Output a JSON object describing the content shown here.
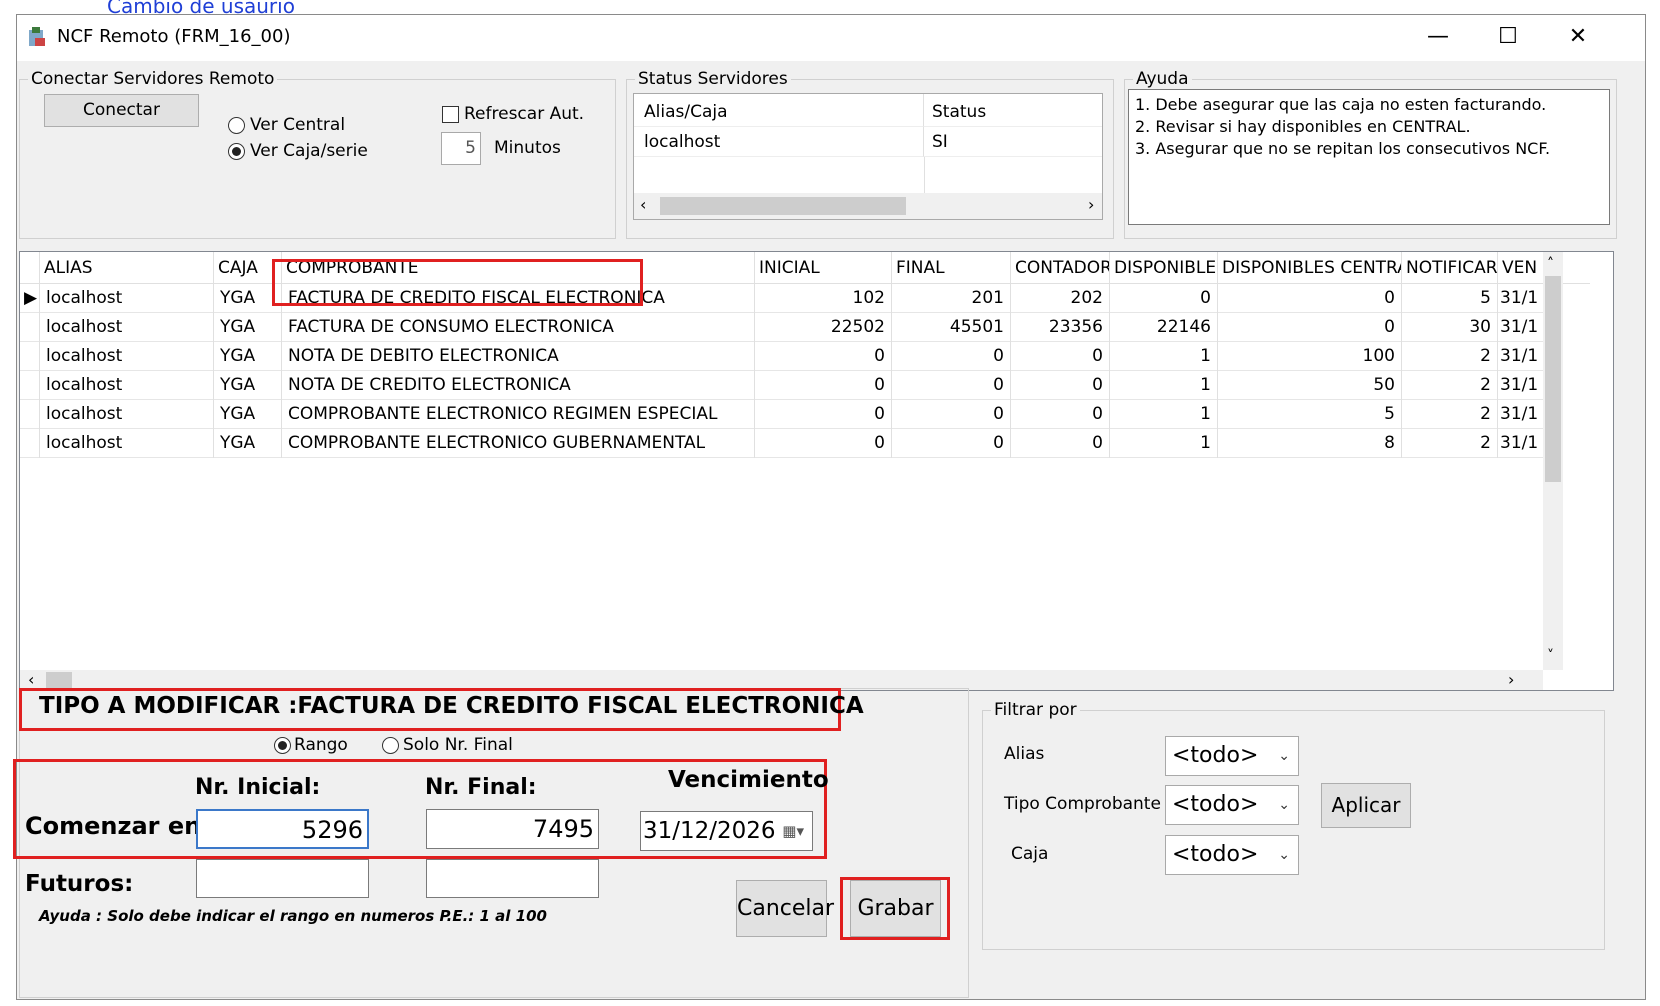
{
  "top_link": "Cambio de usaurio",
  "window": {
    "title": "NCF Remoto (FRM_16_00)",
    "controls": {
      "minimize": "—",
      "maximize": "☐",
      "close": "✕"
    }
  },
  "connect_group": {
    "legend": "Conectar Servidores Remoto",
    "connect_button": "Conectar",
    "radio_central": "Ver Central",
    "radio_caja": "Ver Caja/serie",
    "refresh_checkbox": "Refrescar Aut.",
    "minutes_value": "5",
    "minutes_label": "Minutos"
  },
  "status_group": {
    "legend": "Status Servidores",
    "columns": [
      "Alias/Caja",
      "Status"
    ],
    "rows": [
      [
        "localhost",
        "SI"
      ]
    ]
  },
  "help_group": {
    "legend": "Ayuda",
    "lines": [
      "1. Debe asegurar que las caja no esten facturando.",
      "2. Revisar si hay disponibles en CENTRAL.",
      "3. Asegurar que no se repitan los consecutivos NCF."
    ]
  },
  "grid": {
    "columns": [
      "ALIAS",
      "CAJA",
      "COMPROBANTE",
      "INICIAL",
      "FINAL",
      "CONTADOR",
      "DISPONIBLES",
      "DISPONIBLES CENTRAL",
      "NOTIFICAR",
      "VEN"
    ],
    "rows": [
      [
        "localhost",
        "YGA",
        "FACTURA DE CREDITO FISCAL ELECTRONICA",
        "102",
        "201",
        "202",
        "0",
        "0",
        "5",
        "31/1"
      ],
      [
        "localhost",
        "YGA",
        "FACTURA DE CONSUMO ELECTRONICA",
        "22502",
        "45501",
        "23356",
        "22146",
        "0",
        "30",
        "31/1"
      ],
      [
        "localhost",
        "YGA",
        "NOTA DE DEBITO ELECTRONICA",
        "0",
        "0",
        "0",
        "1",
        "100",
        "2",
        "31/1"
      ],
      [
        "localhost",
        "YGA",
        "NOTA DE CREDITO ELECTRONICA",
        "0",
        "0",
        "0",
        "1",
        "50",
        "2",
        "31/1"
      ],
      [
        "localhost",
        "YGA",
        "COMPROBANTE ELECTRONICO REGIMEN ESPECIAL",
        "0",
        "0",
        "0",
        "1",
        "5",
        "2",
        "31/1"
      ],
      [
        "localhost",
        "YGA",
        "COMPROBANTE ELECTRONICO GUBERNAMENTAL",
        "0",
        "0",
        "0",
        "1",
        "8",
        "2",
        "31/1"
      ]
    ]
  },
  "modify": {
    "title": "TIPO A MODIFICAR :FACTURA DE CREDITO FISCAL ELECTRONICA",
    "radio_rango": "Rango",
    "radio_solo": "Solo Nr. Final",
    "label_inicial": "Nr. Inicial:",
    "label_final": "Nr. Final:",
    "label_vencimiento": "Vencimiento",
    "label_comenzar": "Comenzar en:",
    "inicial_value": "5296",
    "final_value": "7495",
    "vencimiento_value": "31/12/2026",
    "label_futuros": "Futuros:",
    "help_text": "Ayuda : Solo debe indicar el rango en numeros P.E.: 1 al 100",
    "cancel_button": "Cancelar",
    "save_button": "Grabar"
  },
  "filter": {
    "legend": "Filtrar por",
    "alias_label": "Alias",
    "alias_value": "<todo>",
    "tipo_label": "Tipo Comprobante",
    "tipo_value": "<todo>",
    "caja_label": "Caja",
    "caja_value": "<todo>",
    "apply_button": "Aplicar"
  },
  "colors": {
    "highlight": "#e02020",
    "link": "#1f3fd6"
  }
}
